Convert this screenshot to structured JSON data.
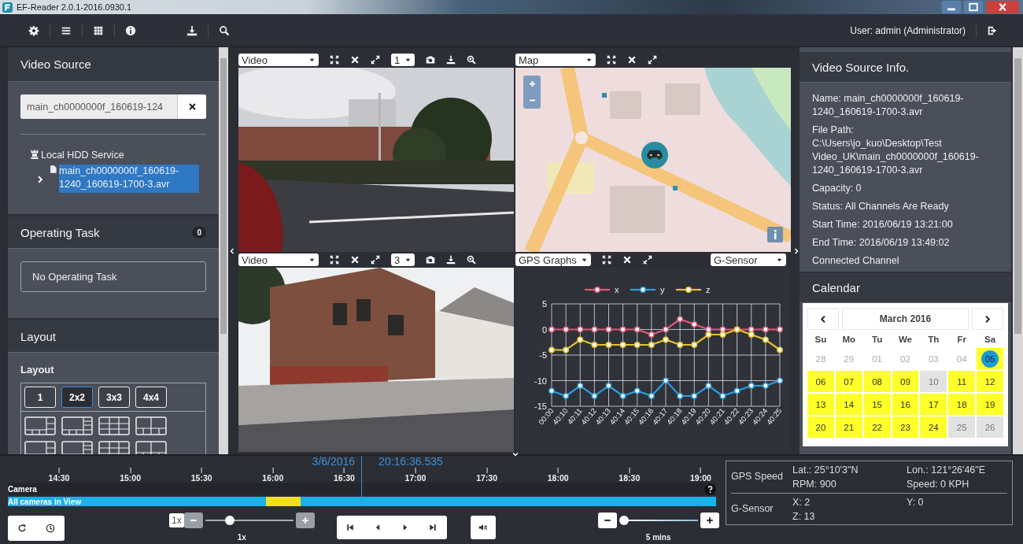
{
  "window": {
    "title": "EF-Reader 2.0.1-2016.0930.1"
  },
  "toolbar": {
    "user": "User: admin (Administrator)"
  },
  "video_source": {
    "title": "Video Source",
    "search": {
      "value": "main_ch0000000f_160619-124"
    },
    "tree": [
      {
        "kind": "service",
        "label": "Local HDD Service",
        "children": [
          {
            "kind": "file",
            "label": "main_ch0000000f_160619-1240_160619-1700-3.avr",
            "selected": true,
            "expanded": false
          }
        ]
      }
    ]
  },
  "operating_task": {
    "title": "Operating Task",
    "count": "0",
    "message": "No Operating Task"
  },
  "layout": {
    "title": "Layout",
    "label": "Layout",
    "presets": [
      {
        "label": "1",
        "selected": false
      },
      {
        "label": "2x2",
        "selected": true
      },
      {
        "label": "3x3",
        "selected": false
      },
      {
        "label": "4x4",
        "selected": false
      }
    ]
  },
  "panes": [
    {
      "kind": "video",
      "source": "Video",
      "channel": "1"
    },
    {
      "kind": "map",
      "source": "Map"
    },
    {
      "kind": "video",
      "source": "Video",
      "channel": "3"
    },
    {
      "kind": "graph",
      "source": "GPS Graphs",
      "sensor": "G-Sensor",
      "chart_data": {
        "type": "line",
        "grid": true,
        "legend": "top",
        "categories": [
          "00:00",
          "40:10",
          "40:11",
          "40:12",
          "40:13",
          "40:14",
          "40:15",
          "40:16",
          "40:17",
          "40:18",
          "40:19",
          "40:20",
          "40:21",
          "40:22",
          "40:23",
          "40:24",
          "40:25"
        ],
        "ylim": [
          -15,
          5
        ],
        "yticks": [
          5,
          0,
          -5,
          -10,
          -15
        ],
        "series": [
          {
            "name": "x",
            "color": "#e05a78",
            "marker": "circle",
            "values": [
              0,
              0,
              0,
              0,
              0,
              0,
              0,
              -1,
              0,
              2,
              1,
              0,
              0,
              0,
              0,
              0,
              0
            ]
          },
          {
            "name": "y",
            "color": "#2f9fe0",
            "marker": "circle",
            "values": [
              -12,
              -13,
              -11,
              -13,
              -11,
              -13,
              -12,
              -13,
              -10,
              -13,
              -13,
              -11,
              -13,
              -12,
              -11,
              -11,
              -10
            ]
          },
          {
            "name": "z",
            "color": "#e8c230",
            "marker": "circle",
            "values": [
              -4,
              -4,
              -2,
              -3,
              -3,
              -3,
              -3,
              -3,
              -2,
              -3,
              -3,
              -1,
              -1,
              0,
              -1,
              -2,
              -4
            ]
          }
        ]
      }
    }
  ],
  "info": {
    "title": "Video Source Info.",
    "lines": [
      "Name: main_ch0000000f_160619-1240_160619-1700-3.avr",
      "File Path:",
      "C:\\Users\\jo_kuo\\Desktop\\Test Video_UK\\main_ch0000000f_160619-1240_160619-1700-3.avr",
      "Capacity: 0",
      "Status: All Channels Are Ready",
      "Start Time: 2016/06/19 13:21:00",
      "End Time: 2016/06/19 13:49:02",
      "Connected Channel"
    ]
  },
  "calendar": {
    "title": "Calendar",
    "month": "March 2016",
    "weekdays": [
      "Su",
      "Mo",
      "Tu",
      "We",
      "Th",
      "Fr",
      "Sa"
    ],
    "days": [
      {
        "label": "28",
        "kind": "other",
        "selected": false
      },
      {
        "label": "29",
        "kind": "other",
        "selected": false
      },
      {
        "label": "01",
        "kind": "other",
        "selected": false
      },
      {
        "label": "02",
        "kind": "other",
        "selected": false
      },
      {
        "label": "03",
        "kind": "other",
        "selected": false
      },
      {
        "label": "04",
        "kind": "other",
        "selected": false
      },
      {
        "label": "05",
        "kind": "recorded",
        "selected": true
      },
      {
        "label": "06",
        "kind": "recorded",
        "selected": false
      },
      {
        "label": "07",
        "kind": "recorded",
        "selected": false
      },
      {
        "label": "08",
        "kind": "recorded",
        "selected": false
      },
      {
        "label": "09",
        "kind": "recorded",
        "selected": false
      },
      {
        "label": "10",
        "kind": "empty",
        "selected": false
      },
      {
        "label": "11",
        "kind": "recorded",
        "selected": false
      },
      {
        "label": "12",
        "kind": "recorded",
        "selected": false
      },
      {
        "label": "13",
        "kind": "recorded",
        "selected": false
      },
      {
        "label": "14",
        "kind": "recorded",
        "selected": false
      },
      {
        "label": "15",
        "kind": "recorded",
        "selected": false
      },
      {
        "label": "16",
        "kind": "recorded",
        "selected": false
      },
      {
        "label": "17",
        "kind": "recorded",
        "selected": false
      },
      {
        "label": "18",
        "kind": "recorded",
        "selected": false
      },
      {
        "label": "19",
        "kind": "recorded",
        "selected": false
      },
      {
        "label": "20",
        "kind": "recorded",
        "selected": false
      },
      {
        "label": "21",
        "kind": "recorded",
        "selected": false
      },
      {
        "label": "22",
        "kind": "recorded",
        "selected": false
      },
      {
        "label": "23",
        "kind": "recorded",
        "selected": false
      },
      {
        "label": "24",
        "kind": "recorded",
        "selected": false
      },
      {
        "label": "25",
        "kind": "empty",
        "selected": false
      },
      {
        "label": "26",
        "kind": "empty",
        "selected": false
      }
    ]
  },
  "timeline": {
    "ticks": [
      "14:30",
      "15:00",
      "15:30",
      "16:00",
      "16:30",
      "17:00",
      "17:30",
      "18:00",
      "18:30",
      "19:00"
    ],
    "date": "3/6/2016",
    "time": "20:16:36.535",
    "level": 0.499,
    "track_label": "Camera",
    "bar_label": "All cameras in View"
  },
  "controls": {
    "speed": {
      "label": "1x",
      "value": "1x",
      "level": 0.28
    },
    "zoom": {
      "value": "5 mins",
      "level": 0.06
    }
  },
  "telemetry": [
    {
      "title": "GPS Speed",
      "fields": [
        "Lat.: 25°10'3\"N",
        "Lon.: 121°26'46\"E",
        "RPM: 900",
        "Speed: 0 KPH"
      ]
    },
    {
      "title": "G-Sensor",
      "fields": [
        "X: 2",
        "Y: 0",
        "Z: 13"
      ]
    }
  ]
}
